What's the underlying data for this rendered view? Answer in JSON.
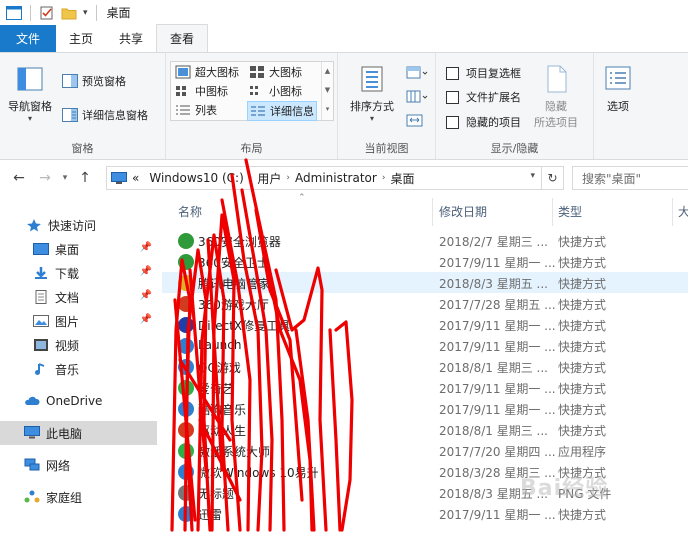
{
  "window": {
    "title": "桌面"
  },
  "tabs": [
    {
      "label": "文件"
    },
    {
      "label": "主页"
    },
    {
      "label": "共享"
    },
    {
      "label": "查看"
    }
  ],
  "ribbon": {
    "panes": {
      "label": "窗格",
      "nav_pane": "导航窗格",
      "preview_pane": "预览窗格",
      "details_pane": "详细信息窗格"
    },
    "layout": {
      "label": "布局",
      "options": [
        "超大图标",
        "大图标",
        "中图标",
        "小图标",
        "列表",
        "详细信息"
      ],
      "selected": "详细信息"
    },
    "current_view": {
      "label": "当前视图",
      "sort_by": "排序方式"
    },
    "show_hide": {
      "label": "显示/隐藏",
      "item_checkboxes": "项目复选框",
      "file_extensions": "文件扩展名",
      "hidden_items": "隐藏的项目",
      "hide": "隐藏",
      "selected_items": "所选项目"
    },
    "options": {
      "label": "选项"
    }
  },
  "address": {
    "overflow": "«",
    "crumbs": [
      "Windows10 (C:)",
      "用户",
      "Administrator",
      "桌面"
    ],
    "search_placeholder": "搜索\"桌面\""
  },
  "nav_pane": {
    "quick_access": "快速访问",
    "items": [
      {
        "label": "桌面",
        "pinned": true
      },
      {
        "label": "下载",
        "pinned": true
      },
      {
        "label": "文档",
        "pinned": true
      },
      {
        "label": "图片",
        "pinned": true
      },
      {
        "label": "视频",
        "pinned": false
      },
      {
        "label": "音乐",
        "pinned": false
      }
    ],
    "onedrive": "OneDrive",
    "this_pc": "此电脑",
    "network": "网络",
    "homegroup": "家庭组"
  },
  "columns": {
    "name": "名称",
    "modified": "修改日期",
    "type": "类型",
    "size": "大"
  },
  "files": [
    {
      "name": "360安全浏览器",
      "date": "2018/2/7 星期三 ...",
      "type": "快捷方式"
    },
    {
      "name": "360安全卫士",
      "date": "2017/9/11 星期一 ...",
      "type": "快捷方式"
    },
    {
      "name": "腾讯电脑管家",
      "date": "2018/8/3 星期五 ...",
      "type": "快捷方式"
    },
    {
      "name": "360游戏大厅",
      "date": "2017/7/28 星期五 ...",
      "type": "快捷方式"
    },
    {
      "name": "DirectX修复工具",
      "date": "2017/9/11 星期一 ...",
      "type": "快捷方式"
    },
    {
      "name": "Launch",
      "date": "2017/9/11 星期一 ...",
      "type": "快捷方式"
    },
    {
      "name": "QQ游戏",
      "date": "2018/8/1 星期三 ...",
      "type": "快捷方式"
    },
    {
      "name": "爱奇艺",
      "date": "2017/9/11 星期一 ...",
      "type": "快捷方式"
    },
    {
      "name": "酷狗音乐",
      "date": "2017/9/11 星期一 ...",
      "type": "快捷方式"
    },
    {
      "name": "驱动人生",
      "date": "2018/8/1 星期三 ...",
      "type": "快捷方式"
    },
    {
      "name": "激活系统大师",
      "date": "2017/7/20 星期四 ...",
      "type": "应用程序"
    },
    {
      "name": "微软Windows 10易升",
      "date": "2018/3/28 星期三 ...",
      "type": "快捷方式"
    },
    {
      "name": "无标题",
      "date": "2018/8/3 星期五 ...",
      "type": "PNG 文件"
    },
    {
      "name": "迅雷",
      "date": "2017/9/11 星期一 ...",
      "type": "快捷方式"
    }
  ],
  "watermark": "Bai经验",
  "colors": {
    "file_tab": "#1979ca",
    "selection": "#cce8ff",
    "row_highlight": "#e5f3ff",
    "scribble": "#ee0000"
  },
  "icons": {
    "window": "explorer-window-icon",
    "nav_back": "arrow-left-icon",
    "nav_forward": "arrow-right-icon",
    "nav_up": "arrow-up-icon",
    "refresh": "refresh-icon",
    "search": "search-icon"
  }
}
